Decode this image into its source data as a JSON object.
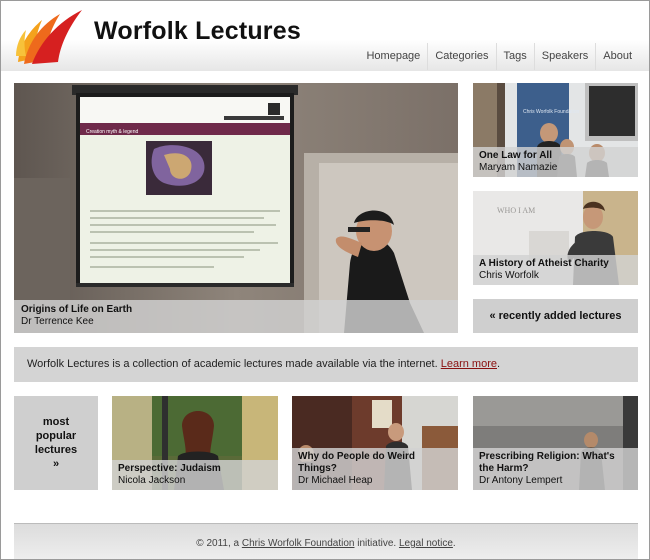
{
  "site": {
    "title": "Worfolk Lectures"
  },
  "nav": [
    "Homepage",
    "Categories",
    "Tags",
    "Speakers",
    "About"
  ],
  "featured": {
    "title": "Origins of Life on Earth",
    "speaker": "Dr Terrence Kee",
    "slide_heading": "Creation myth & legend",
    "slide_brand": "UNIVERSITY OF LEEDS"
  },
  "side": [
    {
      "title": "One Law for All",
      "speaker": "Maryam Namazie",
      "banner": "Chris Worfolk Foundation"
    },
    {
      "title": "A History of Atheist Charity",
      "speaker": "Chris Worfolk",
      "banner": "WHO I AM"
    }
  ],
  "recent_link": "« recently added lectures",
  "intro": {
    "text": "Worfolk Lectures is a collection of academic lectures made available via the internet. ",
    "link": "Learn more",
    "end": "."
  },
  "popular_box": {
    "line1": "most",
    "line2": "popular",
    "line3": "lectures",
    "line4": "»"
  },
  "popular": [
    {
      "title": "Perspective: Judaism",
      "speaker": "Nicola Jackson"
    },
    {
      "title": "Why do People do Weird Things?",
      "speaker": "Dr Michael Heap"
    },
    {
      "title": "Prescribing Religion: What's the Harm?",
      "speaker": "Dr Antony Lempert"
    }
  ],
  "footer": {
    "pre": "© 2011, a ",
    "org": "Chris Worfolk Foundation",
    "mid": " initiative. ",
    "legal": "Legal notice",
    "end": "."
  }
}
